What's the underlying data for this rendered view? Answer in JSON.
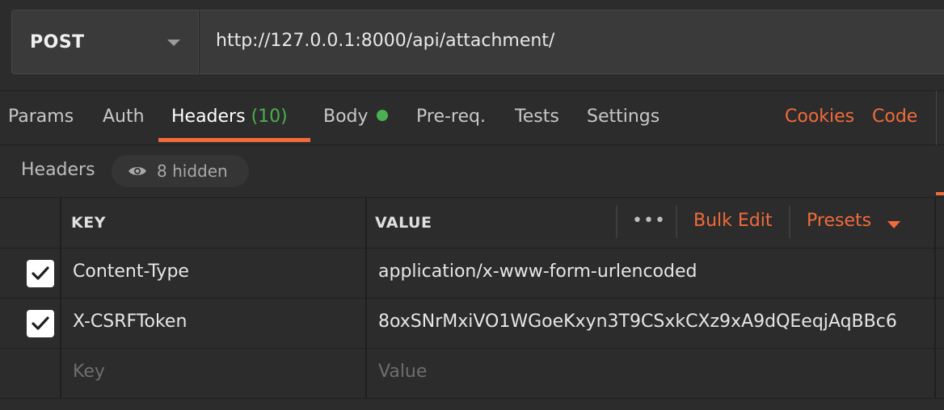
{
  "request": {
    "method": "POST",
    "url": "http://127.0.0.1:8000/api/attachment/"
  },
  "tabs": [
    {
      "label": "Params"
    },
    {
      "label": "Auth"
    },
    {
      "label": "Headers",
      "count": "(10)",
      "active": true
    },
    {
      "label": "Body",
      "indicator": "green-dot"
    },
    {
      "label": "Pre-req."
    },
    {
      "label": "Tests"
    },
    {
      "label": "Settings"
    }
  ],
  "tab_links": {
    "cookies": "Cookies",
    "code": "Code"
  },
  "headers_section": {
    "title": "Headers",
    "hidden_label": "8 hidden",
    "hidden_icon": "eye-icon"
  },
  "table": {
    "key_header": "KEY",
    "value_header": "VALUE",
    "more_icon": "ellipsis-icon",
    "bulk_edit": "Bulk Edit",
    "presets": "Presets",
    "rows": [
      {
        "checked": true,
        "key": "Content-Type",
        "value": "application/x-www-form-urlencoded"
      },
      {
        "checked": true,
        "key": "X-CSRFToken",
        "value": "8oxSNrMxiVO1WGoeKxyn3T9CSxkCXz9xA9dQEeqjAqBBc6"
      }
    ],
    "new_row": {
      "key_placeholder": "Key",
      "value_placeholder": "Value"
    }
  },
  "colors": {
    "background": "#2c2c2c",
    "accent": "#f26b3a",
    "success": "#4caf50",
    "text": "#e6e6e6",
    "placeholder": "#6e6e6e"
  }
}
